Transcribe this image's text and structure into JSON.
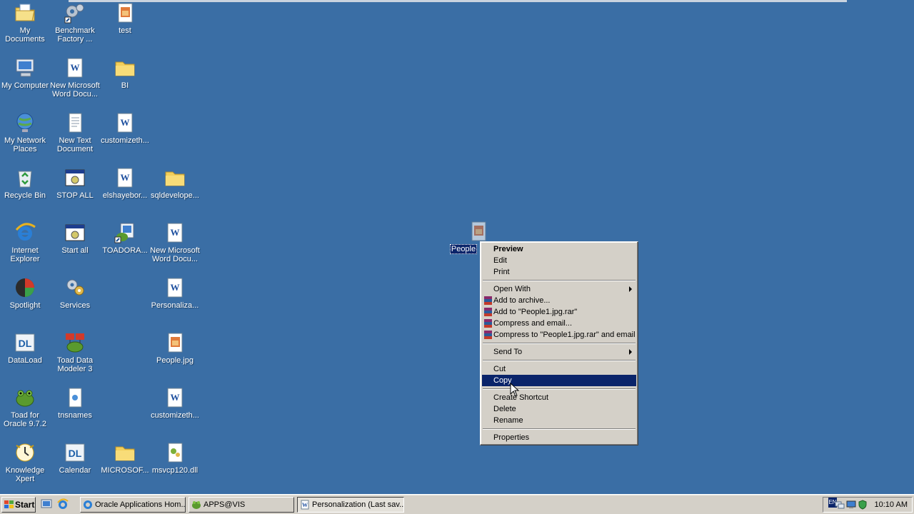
{
  "desktop_icons": [
    {
      "label": "My Documents",
      "icon": "my-documents-icon"
    },
    {
      "label": "Benchmark Factory ...",
      "icon": "benchmark-factory-icon"
    },
    {
      "label": "test",
      "icon": "image-file-icon"
    },
    {
      "label": "My Computer",
      "icon": "my-computer-icon"
    },
    {
      "label": "New Microsoft Word Docu...",
      "icon": "word-document-icon"
    },
    {
      "label": "BI",
      "icon": "folder-icon"
    },
    {
      "label": "My Network Places",
      "icon": "network-places-icon"
    },
    {
      "label": "New Text Document",
      "icon": "text-document-icon"
    },
    {
      "label": "customizeth...",
      "icon": "word-document-icon"
    },
    {
      "label": "Recycle Bin",
      "icon": "recycle-bin-icon"
    },
    {
      "label": "STOP ALL",
      "icon": "batch-file-icon"
    },
    {
      "label": "elshayebor...",
      "icon": "word-document-icon"
    },
    {
      "label": "sqldevelope...",
      "icon": "folder-icon"
    },
    {
      "label": "Internet Explorer",
      "icon": "internet-explorer-icon"
    },
    {
      "label": "Start all",
      "icon": "batch-file-icon"
    },
    {
      "label": "TOADORA...",
      "icon": "toad-shortcut-icon"
    },
    {
      "label": "New Microsoft Word Docu...",
      "icon": "word-document-icon"
    },
    {
      "label": "Spotlight",
      "icon": "spotlight-icon"
    },
    {
      "label": "Services",
      "icon": "services-icon"
    },
    {
      "label": "Personaliza...",
      "icon": "word-document-icon"
    },
    {
      "label": "DataLoad",
      "icon": "dataload-icon"
    },
    {
      "label": "Toad Data Modeler 3",
      "icon": "toad-data-modeler-icon"
    },
    {
      "label": "People.jpg",
      "icon": "image-file-icon"
    },
    {
      "label": "Toad for Oracle 9.7.2",
      "icon": "toad-frog-icon"
    },
    {
      "label": "tnsnames",
      "icon": "text-document-icon"
    },
    {
      "label": "customizeth...",
      "icon": "word-document-icon"
    },
    {
      "label": "Knowledge Xpert",
      "icon": "knowledge-xpert-icon"
    },
    {
      "label": "Calendar",
      "icon": "dataload-icon"
    },
    {
      "label": "MICROSOF...",
      "icon": "folder-icon"
    },
    {
      "label": "msvcp120.dll",
      "icon": "dll-file-icon"
    }
  ],
  "selected_file": {
    "label": "People",
    "icon": "image-file-icon"
  },
  "context_menu": {
    "items": [
      {
        "label": "Preview",
        "bold": true
      },
      {
        "label": "Edit"
      },
      {
        "label": "Print"
      },
      {
        "separator": true
      },
      {
        "label": "Open With",
        "submenu": true
      },
      {
        "label": "Add to archive...",
        "rar": true
      },
      {
        "label": "Add to \"People1.jpg.rar\"",
        "rar": true
      },
      {
        "label": "Compress and email...",
        "rar": true
      },
      {
        "label": "Compress to \"People1.jpg.rar\" and email",
        "rar": true
      },
      {
        "separator": true
      },
      {
        "label": "Send To",
        "submenu": true
      },
      {
        "separator": true
      },
      {
        "label": "Cut"
      },
      {
        "label": "Copy",
        "highlighted": true
      },
      {
        "separator": true
      },
      {
        "label": "Create Shortcut"
      },
      {
        "label": "Delete"
      },
      {
        "label": "Rename"
      },
      {
        "separator": true
      },
      {
        "label": "Properties"
      }
    ]
  },
  "taskbar": {
    "start_label": "Start",
    "tasks": [
      {
        "label": "Oracle Applications Hom...",
        "icon": "ie-page-icon"
      },
      {
        "label": "APPS@VIS",
        "icon": "toad-frog-icon"
      },
      {
        "label": "Personalization (Last sav...",
        "icon": "word-document-icon"
      }
    ],
    "language": "EN",
    "clock": "10:10 AM"
  },
  "colors": {
    "desktop": "#3a6ea5",
    "menu_bg": "#d4d0c8",
    "highlight": "#0a246a"
  }
}
